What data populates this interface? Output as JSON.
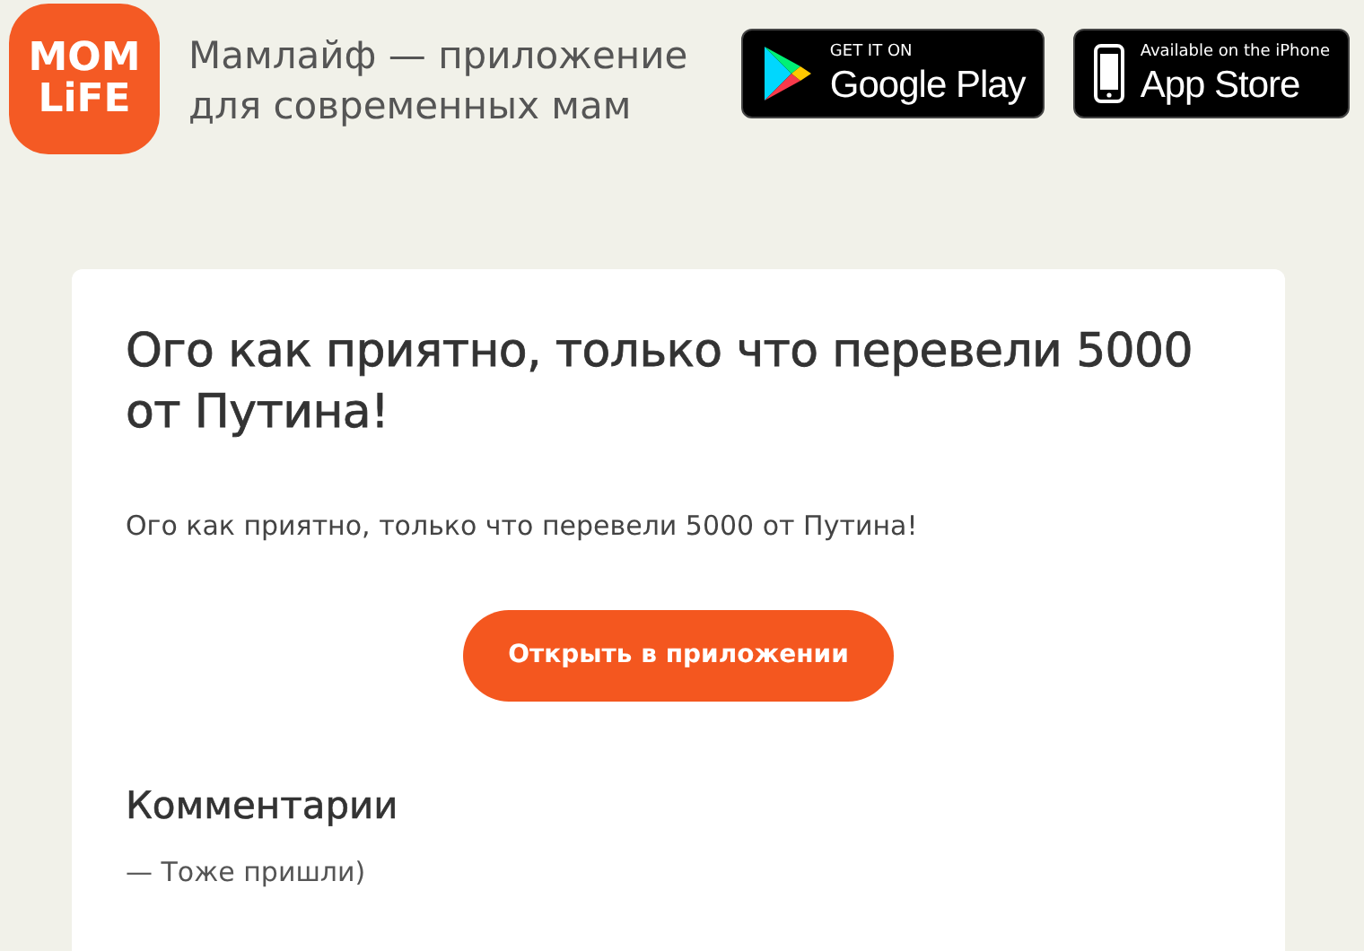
{
  "header": {
    "logo": [
      "MOM",
      "LiFE"
    ],
    "tagline": "Мамлайф — приложение для современных мам",
    "badges": [
      {
        "kind": "google",
        "small": "GET IT ON",
        "big": "Google Play"
      },
      {
        "kind": "apple",
        "small": "Available on the iPhone",
        "big": "App Store"
      }
    ]
  },
  "post": {
    "title": "Ого как приятно, только что перевели 5000 от Путина!",
    "body": "Ого как приятно, только что перевели 5000 от Путина!",
    "button": "Открыть в приложении"
  },
  "comments": {
    "heading": "Комментарии",
    "items": [
      "— Тоже пришли)"
    ]
  }
}
